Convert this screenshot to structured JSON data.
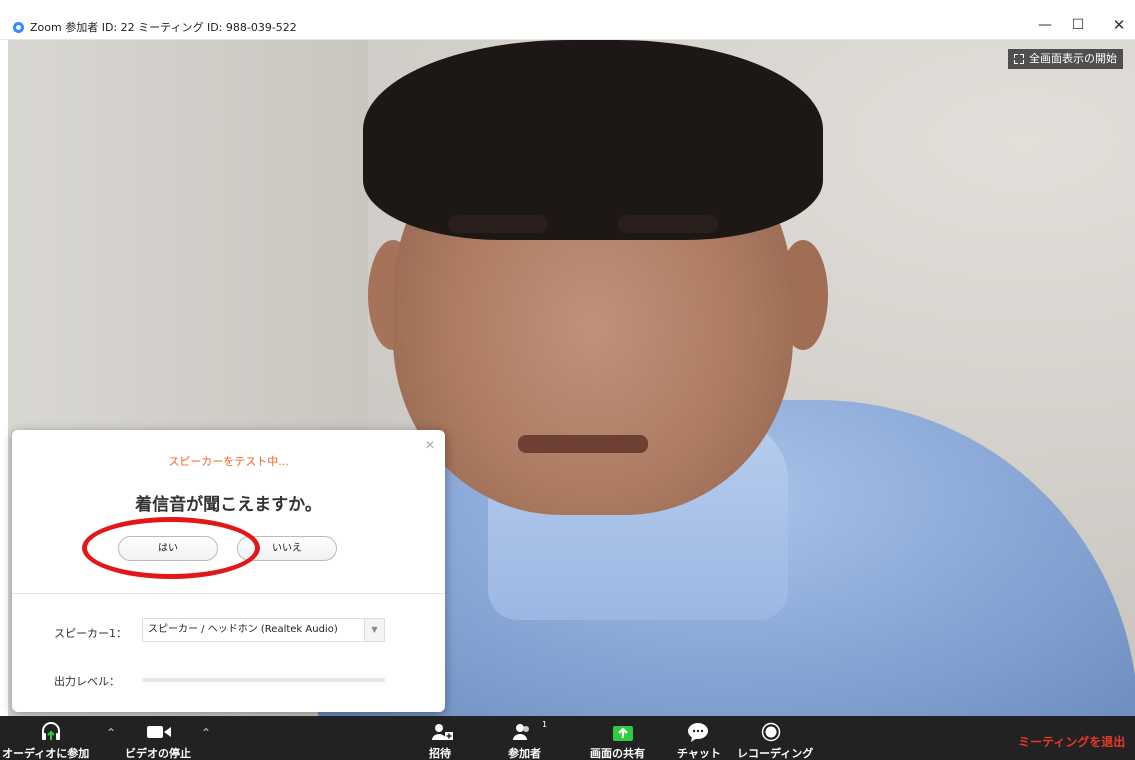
{
  "window": {
    "title": "Zoom 参加者 ID: 22 ミーティング ID: 988-039-522",
    "controls": [
      "minimize",
      "maximize",
      "close"
    ]
  },
  "video": {
    "fullscreen_label": "全画面表示の開始"
  },
  "dialog": {
    "status": "スピーカーをテスト中...",
    "question": "着信音が聞こえますか。",
    "yes_label": "はい",
    "no_label": "いいえ",
    "speaker_label": "スピーカー1：",
    "speaker_value": "スピーカー / ヘッドホン (Realtek Audio)",
    "output_level_label": "出力レベル：",
    "output_level": 0,
    "annotation_color": "#e21818"
  },
  "toolbar": {
    "join_audio": "オーディオに参加",
    "stop_video": "ビデオの停止",
    "invite": "招待",
    "participants": "参加者",
    "participant_count": "1",
    "share_screen": "画面の共有",
    "chat": "チャット",
    "recording": "レコーディング",
    "leave_meeting": "ミーティングを退出",
    "leave_color": "#e8382b",
    "share_color": "#2ecc40"
  }
}
